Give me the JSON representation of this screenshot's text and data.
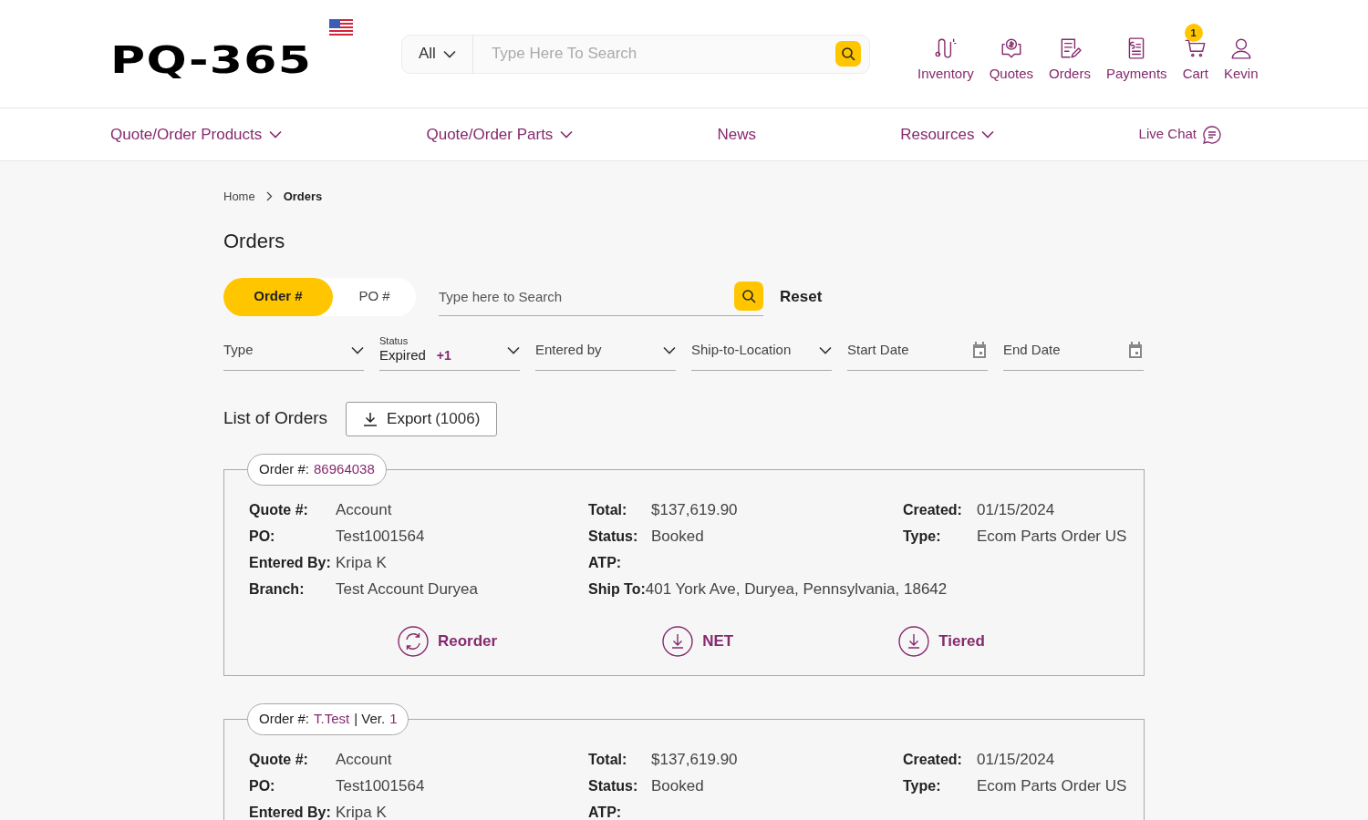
{
  "header": {
    "logo": "PQ-365",
    "search": {
      "scope": "All",
      "placeholder": "Type Here To Search"
    },
    "nav": [
      {
        "kind": "inventory",
        "label": "Inventory"
      },
      {
        "kind": "quotes",
        "label": "Quotes"
      },
      {
        "kind": "orders",
        "label": "Orders"
      },
      {
        "kind": "payments",
        "label": "Payments"
      },
      {
        "kind": "cart",
        "label": "Cart",
        "badge": "1"
      },
      {
        "kind": "user",
        "label": "Kevin"
      }
    ]
  },
  "menu": [
    {
      "label": "Quote/Order Products",
      "dropdown": true
    },
    {
      "label": "Quote/Order Parts",
      "dropdown": true
    },
    {
      "label": "News",
      "dropdown": false
    },
    {
      "label": "Resources",
      "dropdown": true
    }
  ],
  "live_chat": "Live Chat",
  "breadcrumb": [
    {
      "label": "Home",
      "current": false
    },
    {
      "label": "Orders",
      "current": true
    }
  ],
  "title": "Orders",
  "search_by": [
    {
      "label": "Order #",
      "selected": true
    },
    {
      "label": "PO #",
      "selected": false
    }
  ],
  "search": {
    "placeholder": "Type here to Search"
  },
  "reset": "Reset",
  "filters": [
    {
      "kind": "select",
      "label": "Type"
    },
    {
      "kind": "select",
      "label": "Status",
      "value": "Expired",
      "extra": "+1"
    },
    {
      "kind": "select",
      "label": "Entered by"
    },
    {
      "kind": "select",
      "label": "Ship-to-Location"
    },
    {
      "kind": "date",
      "label": "Start Date"
    },
    {
      "kind": "date",
      "label": "End Date"
    }
  ],
  "list_title": "List of Orders",
  "export": {
    "label": "Export",
    "count": "(1006)"
  },
  "orders": [
    {
      "order_label": "Order #:",
      "number": "86964038",
      "columns": [
        [
          {
            "label": "Quote #:",
            "value": "Account"
          },
          {
            "label": "PO:",
            "value": "Test1001564"
          },
          {
            "label": "Entered By:",
            "value": "Kripa K"
          },
          {
            "label": "Branch:",
            "value": "Test Account Duryea"
          }
        ],
        [
          {
            "label": "Total:",
            "value": "$137,619.90"
          },
          {
            "label": "Status:",
            "value": "Booked"
          },
          {
            "label": "ATP:"
          },
          {
            "label": "Ship To:",
            "value": "401 York Ave, Duryea, Pennsylvania, 18642"
          }
        ],
        [
          {
            "label": "Created:",
            "value": "01/15/2024"
          },
          {
            "label": "Type:",
            "value": "Ecom Parts Order US"
          }
        ]
      ],
      "actions": [
        {
          "kind": "reorder",
          "label": "Reorder"
        },
        {
          "kind": "download",
          "label": "NET"
        },
        {
          "kind": "download",
          "label": "Tiered"
        }
      ]
    },
    {
      "order_label": "Order #:",
      "number": "T.Test",
      "version_label": "| Ver.",
      "version": "1",
      "columns": [
        [
          {
            "label": "Quote #:",
            "value": "Account"
          },
          {
            "label": "PO:",
            "value": "Test1001564"
          },
          {
            "label": "Entered By:",
            "value": "Kripa K"
          }
        ],
        [
          {
            "label": "Total:",
            "value": "$137,619.90"
          },
          {
            "label": "Status:",
            "value": "Booked"
          },
          {
            "label": "ATP:"
          }
        ],
        [
          {
            "label": "Created:",
            "value": "01/15/2024"
          },
          {
            "label": "Type:",
            "value": "Ecom Parts Order US"
          }
        ]
      ]
    }
  ]
}
